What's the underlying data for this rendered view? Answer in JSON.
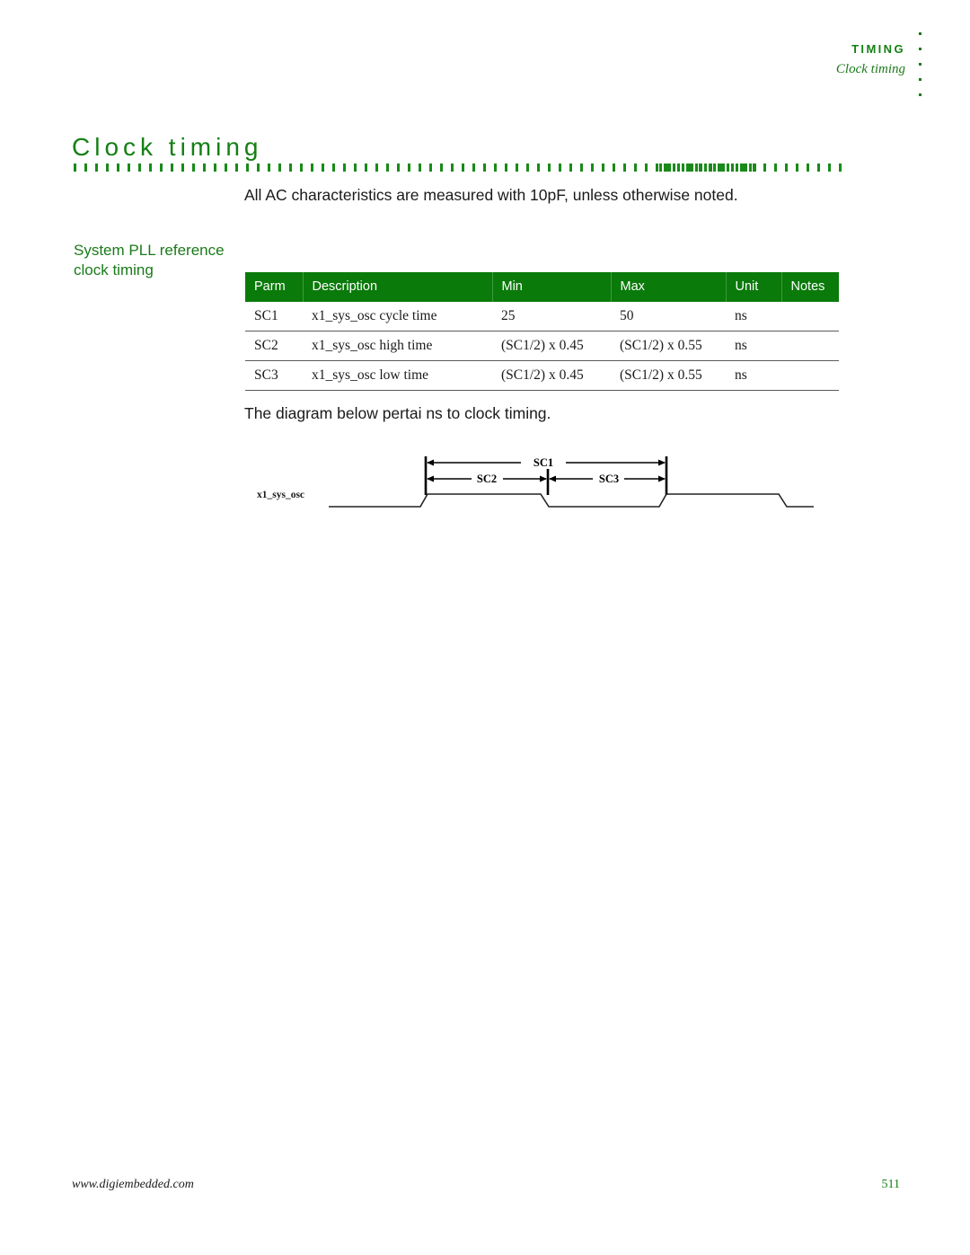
{
  "running_header": {
    "section": "TIMING",
    "subsection": "Clock timing",
    "dot_count": 5,
    "accent_color": "#1a7a1a"
  },
  "page_title": "Clock timing",
  "title_rule": {
    "color": "#1a8a1a",
    "dot_count": 72
  },
  "intro_text": "All AC characteristics are measured with 10pF, unless otherwise noted.",
  "side_heading": "System PLL reference clock timing",
  "table": {
    "header_bg": "#0a7a0a",
    "header_color": "#ffffff",
    "columns": [
      "Parm",
      "Description",
      "Min",
      "Max",
      "Unit",
      "Notes"
    ],
    "rows": [
      {
        "parm": "SC1",
        "description": "x1_sys_osc cycle time",
        "min": "25",
        "max": "50",
        "unit": "ns",
        "notes": ""
      },
      {
        "parm": "SC2",
        "description": "x1_sys_osc high time",
        "min": "(SC1/2) x 0.45",
        "max": "(SC1/2) x 0.55",
        "unit": "ns",
        "notes": ""
      },
      {
        "parm": "SC3",
        "description": "x1_sys_osc low time",
        "min": "(SC1/2) x 0.45",
        "max": "(SC1/2) x 0.55",
        "unit": "ns",
        "notes": ""
      }
    ]
  },
  "diagram_caption": "The diagram below pertai ns to clock timing.",
  "diagram": {
    "signal_label": "x1_sys_osc",
    "measurements": [
      {
        "label": "SC1",
        "span": "full cycle"
      },
      {
        "label": "SC2",
        "span": "high time"
      },
      {
        "label": "SC3",
        "span": "low time"
      }
    ]
  },
  "footer": {
    "url": "www.digiembedded.com",
    "page_number": "511",
    "page_number_color": "#138013"
  }
}
